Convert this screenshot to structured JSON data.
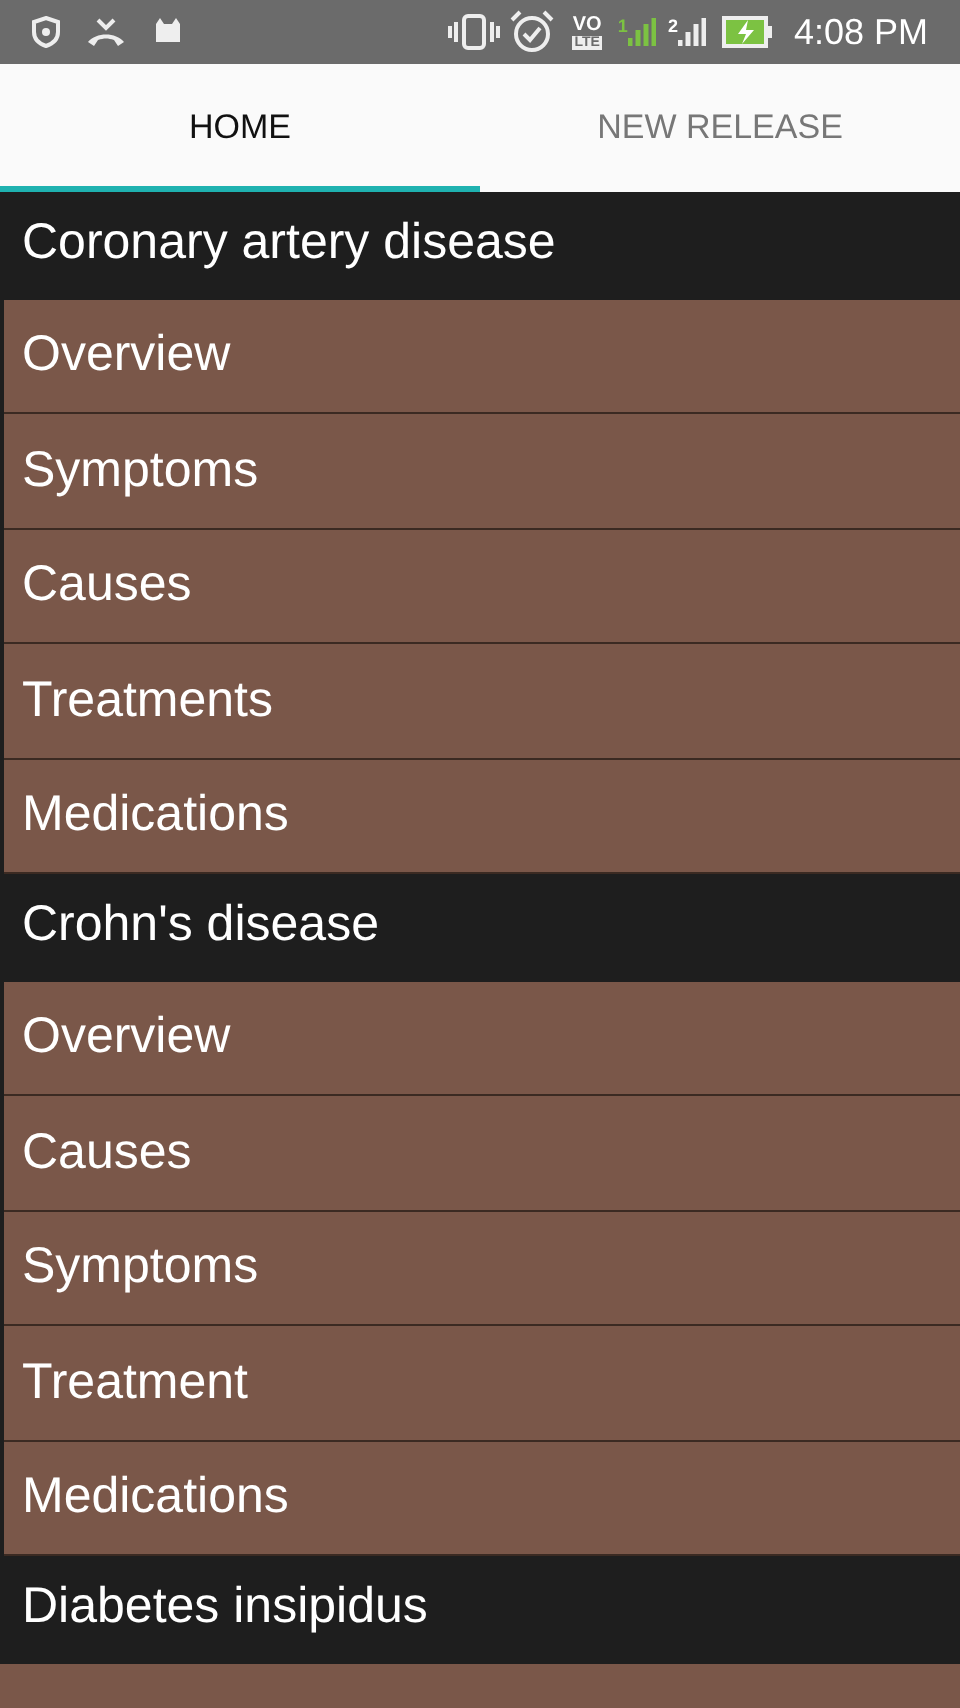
{
  "status_bar": {
    "volte": "VO",
    "lte": "LTE",
    "sim_1": "1",
    "sim_2": "2",
    "time": "4:08 PM"
  },
  "tabs": [
    {
      "label": "HOME",
      "selected": true
    },
    {
      "label": "NEW RELEASE",
      "selected": false
    }
  ],
  "list": [
    {
      "kind": "header",
      "label": "Coronary artery disease"
    },
    {
      "kind": "item",
      "label": "Overview"
    },
    {
      "kind": "item",
      "label": "Symptoms"
    },
    {
      "kind": "item",
      "label": "Causes"
    },
    {
      "kind": "item",
      "label": "Treatments"
    },
    {
      "kind": "item",
      "label": "Medications"
    },
    {
      "kind": "header",
      "label": "Crohn's disease"
    },
    {
      "kind": "item",
      "label": "Overview"
    },
    {
      "kind": "item",
      "label": "Causes"
    },
    {
      "kind": "item",
      "label": "Symptoms"
    },
    {
      "kind": "item",
      "label": "Treatment"
    },
    {
      "kind": "item",
      "label": "Medications"
    },
    {
      "kind": "header",
      "label": "Diabetes insipidus"
    }
  ]
}
